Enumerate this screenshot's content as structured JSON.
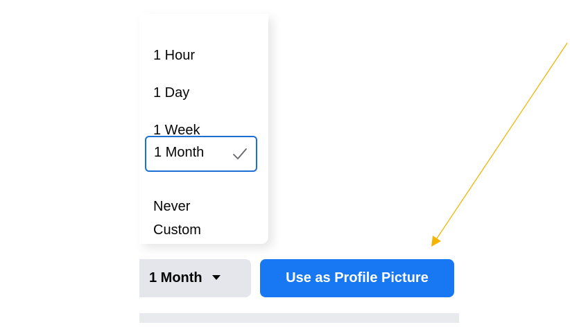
{
  "menu": {
    "items": [
      {
        "label": "1 Hour"
      },
      {
        "label": "1 Day"
      },
      {
        "label": "1 Week"
      },
      {
        "label": "1 Month",
        "selected": true
      },
      {
        "label": "Never"
      },
      {
        "label": "Custom"
      }
    ]
  },
  "controls": {
    "duration_value": "1 Month",
    "primary_button_label": "Use as Profile Picture"
  },
  "colors": {
    "accent": "#1877f2",
    "selected_border": "#1b6fd6",
    "annotation_arrow": "#f5b400"
  },
  "icons": {
    "selected_check": "check-icon",
    "dropdown_caret": "caret-down-icon",
    "annotation": "arrow-annotation"
  }
}
